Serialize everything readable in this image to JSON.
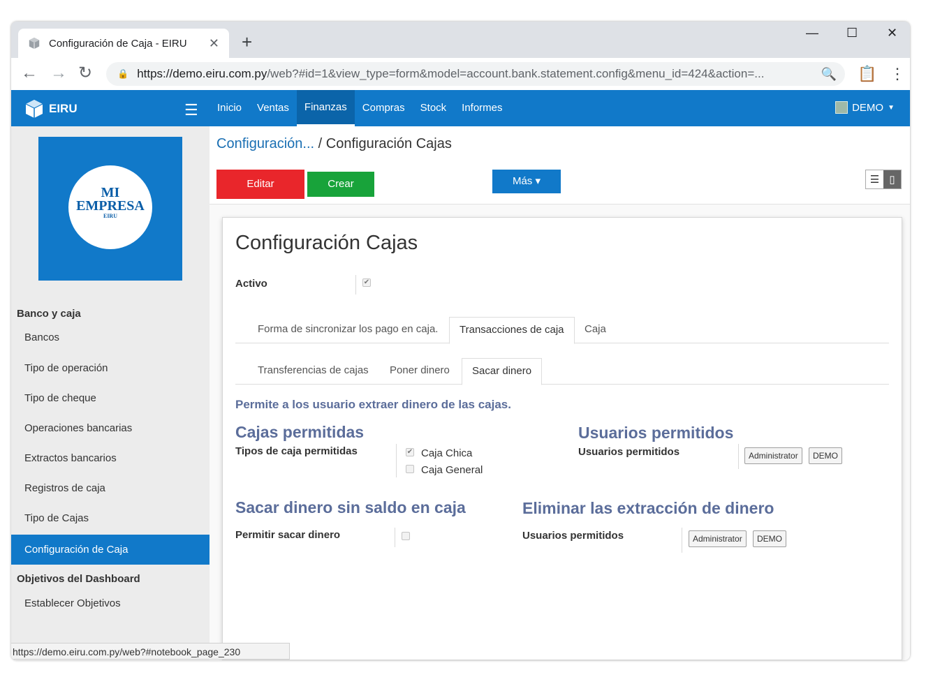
{
  "browser": {
    "tab_title": "Configuración de Caja - EIRU",
    "tab_close": "✕",
    "new_tab": "+",
    "url_host": "https://demo.eiru.com.py",
    "url_path": "/web?#id=1&view_type=form&model=account.bank.statement.config&menu_id=424&action=...",
    "status_url": "https://demo.eiru.com.py/web?#notebook_page_230"
  },
  "navbar": {
    "brand": "EIRU",
    "menu": [
      {
        "label": "Inicio",
        "active": false
      },
      {
        "label": "Ventas",
        "active": false
      },
      {
        "label": "Finanzas",
        "active": true
      },
      {
        "label": "Compras",
        "active": false
      },
      {
        "label": "Stock",
        "active": false
      },
      {
        "label": "Informes",
        "active": false
      }
    ],
    "user": "DEMO"
  },
  "sidebar": {
    "logo": {
      "line1": "MI",
      "line2": "EMPRESA",
      "line3": "EIRU"
    },
    "section1": "Banco y caja",
    "items": [
      "Bancos",
      "Tipo de operación",
      "Tipo de cheque",
      "Operaciones bancarias",
      "Extractos bancarios",
      "Registros de caja",
      "Tipo de Cajas",
      "Configuración de Caja"
    ],
    "section2": "Objetivos del Dashboard",
    "items2": [
      "Establecer Objetivos"
    ]
  },
  "breadcrumb": {
    "parent": "Configuración...",
    "separator": "/",
    "current": "Configuración Cajas"
  },
  "buttons": {
    "edit": "Editar",
    "create": "Crear",
    "more": "Más ▾"
  },
  "form": {
    "title": "Configuración Cajas",
    "active_label": "Activo",
    "active_checked": true,
    "tabs": [
      "Forma de sincronizar los pago en caja.",
      "Transacciones de caja",
      "Caja"
    ],
    "active_tab": 1,
    "subtabs": [
      "Transferencias de cajas",
      "Poner dinero",
      "Sacar dinero"
    ],
    "active_subtab": 2,
    "description": "Permite a los usuario extraer dinero de las cajas.",
    "cajas_title": "Cajas permitidas",
    "cajas_label": "Tipos de caja permitidas",
    "caja_options": [
      {
        "label": "Caja Chica",
        "checked": true
      },
      {
        "label": "Caja General",
        "checked": false
      }
    ],
    "usuarios_title": "Usuarios permitidos",
    "usuarios_label": "Usuarios permitidos",
    "usuarios_tags": [
      "Administrator",
      "DEMO"
    ],
    "sin_saldo_title": "Sacar dinero sin saldo en caja",
    "sin_saldo_label": "Permitir sacar dinero",
    "sin_saldo_checked": false,
    "eliminar_title": "Eliminar las extracción de dinero",
    "eliminar_label": "Usuarios permitidos",
    "eliminar_tags": [
      "Administrator",
      "DEMO"
    ]
  }
}
